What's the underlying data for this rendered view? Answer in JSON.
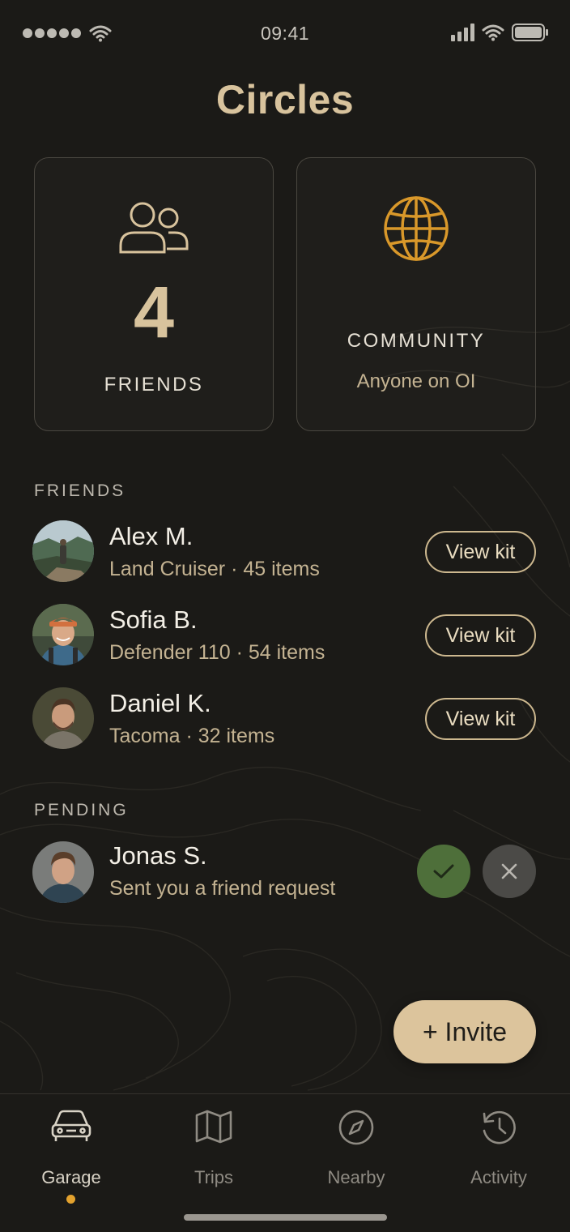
{
  "status_bar": {
    "time": "09:41"
  },
  "header": {
    "title": "Circles"
  },
  "cards": {
    "friends": {
      "count": "4",
      "label": "FRIENDS"
    },
    "community": {
      "label": "COMMUNITY",
      "subtitle": "Anyone on OI"
    }
  },
  "friends_section": {
    "title": "FRIENDS",
    "items": [
      {
        "name": "Alex M.",
        "subtitle": "Land Cruiser · 45 items",
        "action": "View kit"
      },
      {
        "name": "Sofia B.",
        "subtitle": "Defender 110 · 54 items",
        "action": "View kit"
      },
      {
        "name": "Daniel K.",
        "subtitle": "Tacoma · 32 items",
        "action": "View kit"
      }
    ]
  },
  "pending_section": {
    "title": "PENDING",
    "items": [
      {
        "name": "Jonas S.",
        "subtitle": "Sent you a friend request"
      }
    ]
  },
  "invite_button": {
    "label": "+ Invite"
  },
  "tab_bar": {
    "active": "Garage",
    "tabs": [
      {
        "label": "Garage",
        "icon": "car-icon"
      },
      {
        "label": "Trips",
        "icon": "map-icon"
      },
      {
        "label": "Nearby",
        "icon": "compass-icon"
      },
      {
        "label": "Activity",
        "icon": "history-icon"
      }
    ]
  },
  "colors": {
    "background": "#1b1a17",
    "accent_gold": "#d8c39d",
    "icon_orange": "#d9982a",
    "accept_green": "#4e6f3a",
    "active_dot": "#e3a22e"
  }
}
